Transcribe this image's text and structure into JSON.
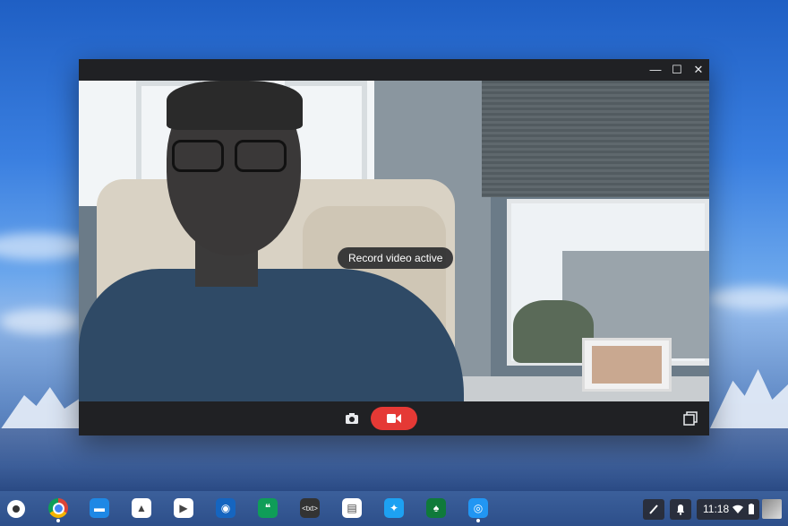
{
  "window": {
    "toast": "Record video active"
  },
  "shelf": {
    "apps": [
      {
        "name": "chrome-app-icon",
        "bg": "#ffffff",
        "glyph": ""
      },
      {
        "name": "files-app-icon",
        "bg": "#1e88e5",
        "glyph": "▬"
      },
      {
        "name": "drive-app-icon",
        "bg": "#ffffff",
        "glyph": "▲"
      },
      {
        "name": "play-store-app-icon",
        "bg": "#ffffff",
        "glyph": "▶"
      },
      {
        "name": "camera-store-app-icon",
        "bg": "#1565c0",
        "glyph": "◉"
      },
      {
        "name": "hangouts-app-icon",
        "bg": "#0f9d58",
        "glyph": "❝"
      },
      {
        "name": "text-editor-app-icon",
        "bg": "#333333",
        "glyph": "<txt>"
      },
      {
        "name": "printer-app-icon",
        "bg": "#ffffff",
        "glyph": "▤"
      },
      {
        "name": "twitter-app-icon",
        "bg": "#1da1f2",
        "glyph": "✦"
      },
      {
        "name": "solitaire-app-icon",
        "bg": "#0f7a3a",
        "glyph": "♠"
      },
      {
        "name": "camera-app-icon",
        "bg": "#2196f3",
        "glyph": "◎"
      }
    ],
    "time": "11:18"
  }
}
